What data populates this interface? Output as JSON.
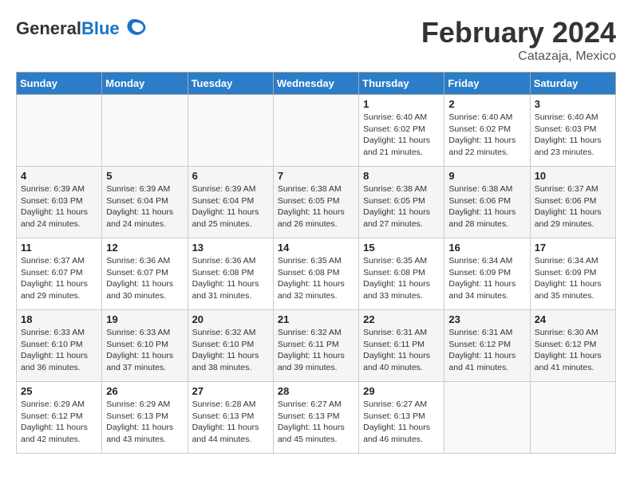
{
  "header": {
    "logo_general": "General",
    "logo_blue": "Blue",
    "month_title": "February 2024",
    "location": "Catazaja, Mexico"
  },
  "days_of_week": [
    "Sunday",
    "Monday",
    "Tuesday",
    "Wednesday",
    "Thursday",
    "Friday",
    "Saturday"
  ],
  "weeks": [
    [
      {
        "day": "",
        "info": ""
      },
      {
        "day": "",
        "info": ""
      },
      {
        "day": "",
        "info": ""
      },
      {
        "day": "",
        "info": ""
      },
      {
        "day": "1",
        "info": "Sunrise: 6:40 AM\nSunset: 6:02 PM\nDaylight: 11 hours and 21 minutes."
      },
      {
        "day": "2",
        "info": "Sunrise: 6:40 AM\nSunset: 6:02 PM\nDaylight: 11 hours and 22 minutes."
      },
      {
        "day": "3",
        "info": "Sunrise: 6:40 AM\nSunset: 6:03 PM\nDaylight: 11 hours and 23 minutes."
      }
    ],
    [
      {
        "day": "4",
        "info": "Sunrise: 6:39 AM\nSunset: 6:03 PM\nDaylight: 11 hours and 24 minutes."
      },
      {
        "day": "5",
        "info": "Sunrise: 6:39 AM\nSunset: 6:04 PM\nDaylight: 11 hours and 24 minutes."
      },
      {
        "day": "6",
        "info": "Sunrise: 6:39 AM\nSunset: 6:04 PM\nDaylight: 11 hours and 25 minutes."
      },
      {
        "day": "7",
        "info": "Sunrise: 6:38 AM\nSunset: 6:05 PM\nDaylight: 11 hours and 26 minutes."
      },
      {
        "day": "8",
        "info": "Sunrise: 6:38 AM\nSunset: 6:05 PM\nDaylight: 11 hours and 27 minutes."
      },
      {
        "day": "9",
        "info": "Sunrise: 6:38 AM\nSunset: 6:06 PM\nDaylight: 11 hours and 28 minutes."
      },
      {
        "day": "10",
        "info": "Sunrise: 6:37 AM\nSunset: 6:06 PM\nDaylight: 11 hours and 29 minutes."
      }
    ],
    [
      {
        "day": "11",
        "info": "Sunrise: 6:37 AM\nSunset: 6:07 PM\nDaylight: 11 hours and 29 minutes."
      },
      {
        "day": "12",
        "info": "Sunrise: 6:36 AM\nSunset: 6:07 PM\nDaylight: 11 hours and 30 minutes."
      },
      {
        "day": "13",
        "info": "Sunrise: 6:36 AM\nSunset: 6:08 PM\nDaylight: 11 hours and 31 minutes."
      },
      {
        "day": "14",
        "info": "Sunrise: 6:35 AM\nSunset: 6:08 PM\nDaylight: 11 hours and 32 minutes."
      },
      {
        "day": "15",
        "info": "Sunrise: 6:35 AM\nSunset: 6:08 PM\nDaylight: 11 hours and 33 minutes."
      },
      {
        "day": "16",
        "info": "Sunrise: 6:34 AM\nSunset: 6:09 PM\nDaylight: 11 hours and 34 minutes."
      },
      {
        "day": "17",
        "info": "Sunrise: 6:34 AM\nSunset: 6:09 PM\nDaylight: 11 hours and 35 minutes."
      }
    ],
    [
      {
        "day": "18",
        "info": "Sunrise: 6:33 AM\nSunset: 6:10 PM\nDaylight: 11 hours and 36 minutes."
      },
      {
        "day": "19",
        "info": "Sunrise: 6:33 AM\nSunset: 6:10 PM\nDaylight: 11 hours and 37 minutes."
      },
      {
        "day": "20",
        "info": "Sunrise: 6:32 AM\nSunset: 6:10 PM\nDaylight: 11 hours and 38 minutes."
      },
      {
        "day": "21",
        "info": "Sunrise: 6:32 AM\nSunset: 6:11 PM\nDaylight: 11 hours and 39 minutes."
      },
      {
        "day": "22",
        "info": "Sunrise: 6:31 AM\nSunset: 6:11 PM\nDaylight: 11 hours and 40 minutes."
      },
      {
        "day": "23",
        "info": "Sunrise: 6:31 AM\nSunset: 6:12 PM\nDaylight: 11 hours and 41 minutes."
      },
      {
        "day": "24",
        "info": "Sunrise: 6:30 AM\nSunset: 6:12 PM\nDaylight: 11 hours and 41 minutes."
      }
    ],
    [
      {
        "day": "25",
        "info": "Sunrise: 6:29 AM\nSunset: 6:12 PM\nDaylight: 11 hours and 42 minutes."
      },
      {
        "day": "26",
        "info": "Sunrise: 6:29 AM\nSunset: 6:13 PM\nDaylight: 11 hours and 43 minutes."
      },
      {
        "day": "27",
        "info": "Sunrise: 6:28 AM\nSunset: 6:13 PM\nDaylight: 11 hours and 44 minutes."
      },
      {
        "day": "28",
        "info": "Sunrise: 6:27 AM\nSunset: 6:13 PM\nDaylight: 11 hours and 45 minutes."
      },
      {
        "day": "29",
        "info": "Sunrise: 6:27 AM\nSunset: 6:13 PM\nDaylight: 11 hours and 46 minutes."
      },
      {
        "day": "",
        "info": ""
      },
      {
        "day": "",
        "info": ""
      }
    ]
  ]
}
